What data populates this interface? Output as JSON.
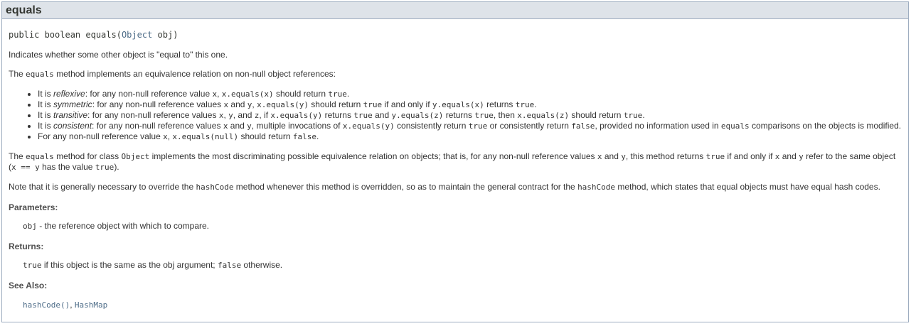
{
  "header": {
    "title": "equals"
  },
  "signature": {
    "prefix": "public boolean equals(",
    "param_type": "Object",
    "suffix": " obj)"
  },
  "intro": "Indicates whether some other object is \"equal to\" this one.",
  "equivalence": {
    "pre": "The ",
    "code": "equals",
    "post": " method implements an equivalence relation on non-null object references:"
  },
  "bullets": {
    "reflexive": {
      "t1": "It is ",
      "em": "reflexive",
      "t2": ": for any non-null reference value ",
      "c1": "x",
      "t3": ", ",
      "c2": "x.equals(x)",
      "t4": " should return ",
      "c3": "true",
      "t5": "."
    },
    "symmetric": {
      "t1": "It is ",
      "em": "symmetric",
      "t2": ": for any non-null reference values ",
      "c1": "x",
      "t3": " and ",
      "c2": "y",
      "t4": ", ",
      "c3": "x.equals(y)",
      "t5": " should return ",
      "c4": "true",
      "t6": " if and only if ",
      "c5": "y.equals(x)",
      "t7": " returns ",
      "c6": "true",
      "t8": "."
    },
    "transitive": {
      "t1": "It is ",
      "em": "transitive",
      "t2": ": for any non-null reference values ",
      "c1": "x",
      "t3": ", ",
      "c2": "y",
      "t4": ", and ",
      "c3": "z",
      "t5": ", if ",
      "c4": "x.equals(y)",
      "t6": " returns ",
      "c5": "true",
      "t7": " and ",
      "c6": "y.equals(z)",
      "t8": " returns ",
      "c7": "true",
      "t9": ", then ",
      "c8": "x.equals(z)",
      "t10": " should return ",
      "c9": "true",
      "t11": "."
    },
    "consistent": {
      "t1": "It is ",
      "em": "consistent",
      "t2": ": for any non-null reference values ",
      "c1": "x",
      "t3": " and ",
      "c2": "y",
      "t4": ", multiple invocations of ",
      "c3": "x.equals(y)",
      "t5": " consistently return ",
      "c4": "true",
      "t6": " or consistently return ",
      "c5": "false",
      "t7": ", provided no information used in ",
      "c6": "equals",
      "t8": " comparisons on the objects is modified."
    },
    "nonnull": {
      "t1": "For any non-null reference value ",
      "c1": "x",
      "t2": ", ",
      "c2": "x.equals(null)",
      "t3": " should return ",
      "c3": "false",
      "t4": "."
    }
  },
  "object_para": {
    "t1": "The ",
    "c1": "equals",
    "t2": " method for class ",
    "c2": "Object",
    "t3": " implements the most discriminating possible equivalence relation on objects; that is, for any non-null reference values ",
    "c3": "x",
    "t4": " and ",
    "c4": "y",
    "t5": ", this method returns ",
    "c5": "true",
    "t6": " if and only if ",
    "c6": "x",
    "t7": " and ",
    "c7": "y",
    "t8": " refer to the same object (",
    "c8": "x == y",
    "t9": " has the value ",
    "c9": "true",
    "t10": ")."
  },
  "hash_para": {
    "t1": "Note that it is generally necessary to override the ",
    "c1": "hashCode",
    "t2": " method whenever this method is overridden, so as to maintain the general contract for the ",
    "c2": "hashCode",
    "t3": " method, which states that equal objects must have equal hash codes."
  },
  "parameters": {
    "label": "Parameters:",
    "name": "obj",
    "desc": " - the reference object with which to compare."
  },
  "returns": {
    "label": "Returns:",
    "c1": "true",
    "t1": " if this object is the same as the obj argument; ",
    "c2": "false",
    "t2": " otherwise."
  },
  "see_also": {
    "label": "See Also:",
    "link1": "hashCode()",
    "sep": ", ",
    "link2": "HashMap"
  },
  "colors": {
    "header_bg": "#dee3e9",
    "border": "#9eadc0",
    "link": "#4c6b87",
    "text": "#333333"
  }
}
